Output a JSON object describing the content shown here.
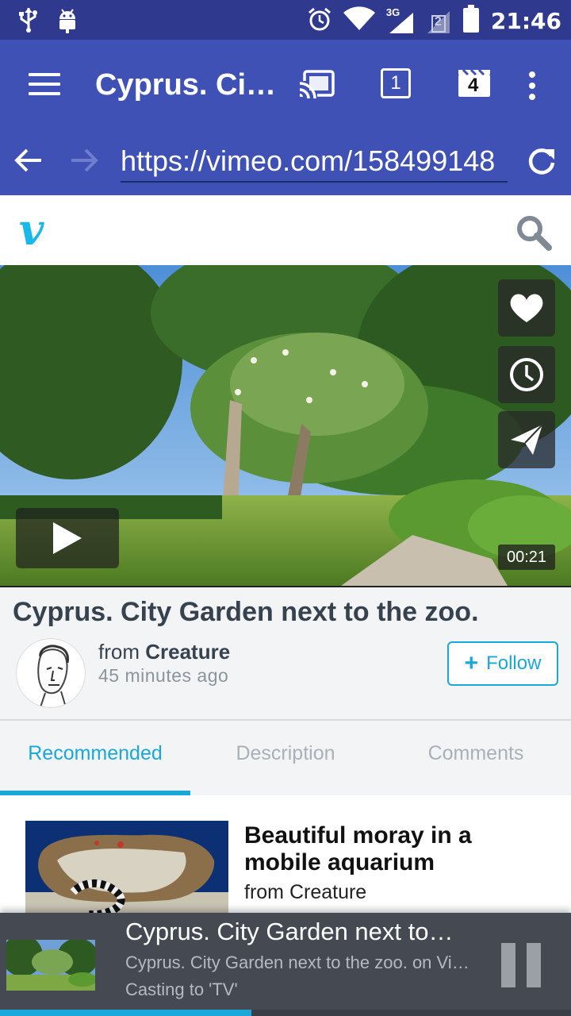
{
  "status_bar": {
    "time": "21:46",
    "icons": [
      "usb-icon",
      "android-debug-icon",
      "alarm-icon",
      "wifi-icon",
      "3g-signal-icon",
      "sim-2-icon",
      "battery-icon"
    ],
    "network_label": "3G",
    "sim_label": "2"
  },
  "toolbar": {
    "tab_title": "Cyprus. City Garden next to the zoo.",
    "tab_count": "1",
    "queue_count": "4",
    "url": "https://vimeo.com/158499148"
  },
  "vimeo": {
    "logo": "v"
  },
  "video": {
    "duration": "00:21",
    "title": "Cyprus. City Garden next to the zoo.",
    "from_prefix": "from",
    "author": "Creature",
    "posted": "45 minutes ago",
    "follow_label": "Follow"
  },
  "tabs": [
    {
      "label": "Recommended",
      "active": true
    },
    {
      "label": "Description",
      "active": false
    },
    {
      "label": "Comments",
      "active": false
    }
  ],
  "recommended": [
    {
      "title": "Beautiful moray in a mobile aquarium",
      "from": "from Creature"
    }
  ],
  "cast_bar": {
    "title": "Cyprus. City Garden next to the zoo.",
    "subtitle": "Cyprus. City Garden next to the zoo. on Vimeo",
    "status": "Casting to 'TV'",
    "progress": 0.44
  },
  "colors": {
    "status_bar": "#2f3a8f",
    "toolbar": "#3f51b5",
    "accent": "#1aa7d9",
    "cast_bar": "#454a52"
  }
}
